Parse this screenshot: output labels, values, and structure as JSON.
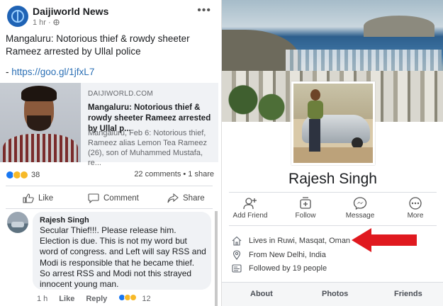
{
  "post": {
    "page_name": "Daijiworld News",
    "time": "1 hr · ",
    "text": "Mangaluru: Notorious thief & rowdy sheeter Rameez arrested by Ullal police",
    "link_prefix": "- ",
    "link_url": "https://goo.gl/1jfxL7",
    "preview": {
      "domain": "DAIJIWORLD.COM",
      "title": "Mangaluru: Notorious thief & rowdy sheeter Rameez arrested by Ullal p...",
      "description": "Mangaluru, Feb 6: Notorious thief, Rameez alias Lemon Tea Rameez (26), son of Muhammed Mustafa, re..."
    },
    "reaction_count": "38",
    "stats": "22 comments • 1 share",
    "actions": {
      "like": "Like",
      "comment": "Comment",
      "share": "Share"
    }
  },
  "comment": {
    "author": "Rajesh Singh",
    "text": "Secular Thief!!!.  Please release him. Election is due. This is not my word but word of congress. and Left will say RSS and Modi is responsible that he became thief. So arrest RSS and Modi not this strayed  innocent young man.",
    "time": "1 h",
    "like": "Like",
    "reply": "Reply",
    "reaction_count": "12"
  },
  "profile": {
    "name": "Rajesh Singh",
    "actions": {
      "add_friend": "Add Friend",
      "follow": "Follow",
      "message": "Message",
      "more": "More"
    },
    "info": {
      "lives": "Lives in Ruwi, Masqat, Oman",
      "from": "From New Delhi, India",
      "followed": "Followed by 19 people"
    },
    "tabs": {
      "about": "About",
      "photos": "Photos",
      "friends": "Friends"
    }
  },
  "colors": {
    "link": "#2a6fb5",
    "like_blue": "#1877f2",
    "reaction_yellow": "#f7b928",
    "annotation_arrow": "#e0191f"
  },
  "icons": [
    "globe-icon",
    "more-dots-icon",
    "like-icon",
    "comment-icon",
    "share-icon",
    "add-friend-icon",
    "follow-icon",
    "messenger-icon",
    "more-icon",
    "home-icon",
    "location-pin-icon",
    "followers-icon",
    "annotation-arrow"
  ]
}
